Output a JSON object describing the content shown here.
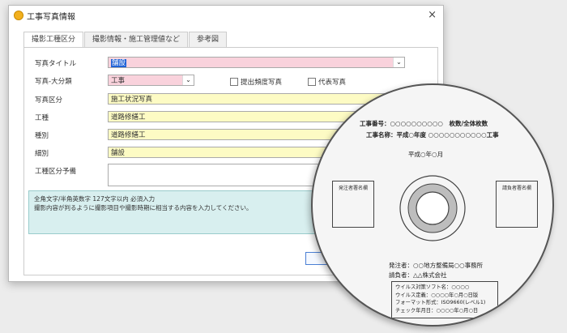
{
  "window": {
    "title": "工事写真情報",
    "close": "×"
  },
  "tabs": [
    {
      "label": "撮影工種区分"
    },
    {
      "label": "撮影情報・施工管理値など"
    },
    {
      "label": "参考図"
    }
  ],
  "form": {
    "labels": {
      "photo_title": "写真タイトル",
      "major_category": "写真-大分類",
      "photo_section": "写真区分",
      "work_type": "工種",
      "kind": "種別",
      "detail": "細別",
      "spare": "工種区分予備"
    },
    "values": {
      "photo_title": "舗設",
      "major_category": "工事",
      "photo_section": "施工状況写真",
      "work_type": "道路修繕工",
      "kind": "道路修繕工",
      "detail": "舗設",
      "spare": ""
    },
    "checkboxes": [
      {
        "label": "提出頻度写真",
        "checked": false
      },
      {
        "label": "代表写真",
        "checked": false
      }
    ],
    "hint_line1": "全角文字/半角英数字 127文字以内 必須入力",
    "hint_line2": "撮影内容が判るように撮影項目や撮影時期に相当する内容を入力してください。"
  },
  "disc": {
    "project_no": "工事番号：○○○○○○○○○○　枚数/全体枚数",
    "project_name": "工事名称：平成○年度 ○○○○○○○○○○○工事",
    "date": "平成○年○月",
    "orderer_sign": "発注者署名欄",
    "contractor_sign": "請負者署名欄",
    "orderer": "発注者：○○地方整備局○○事務所",
    "contractor": "請負者：△△株式会社",
    "info": [
      "ウイルス対策ソフト名：○○○○",
      "ウイルス定義：○○○○年○月○日版",
      "フォーマット形式：ISO9660(レベル1)",
      "チェック年月日：○○○○年○月○日"
    ]
  }
}
